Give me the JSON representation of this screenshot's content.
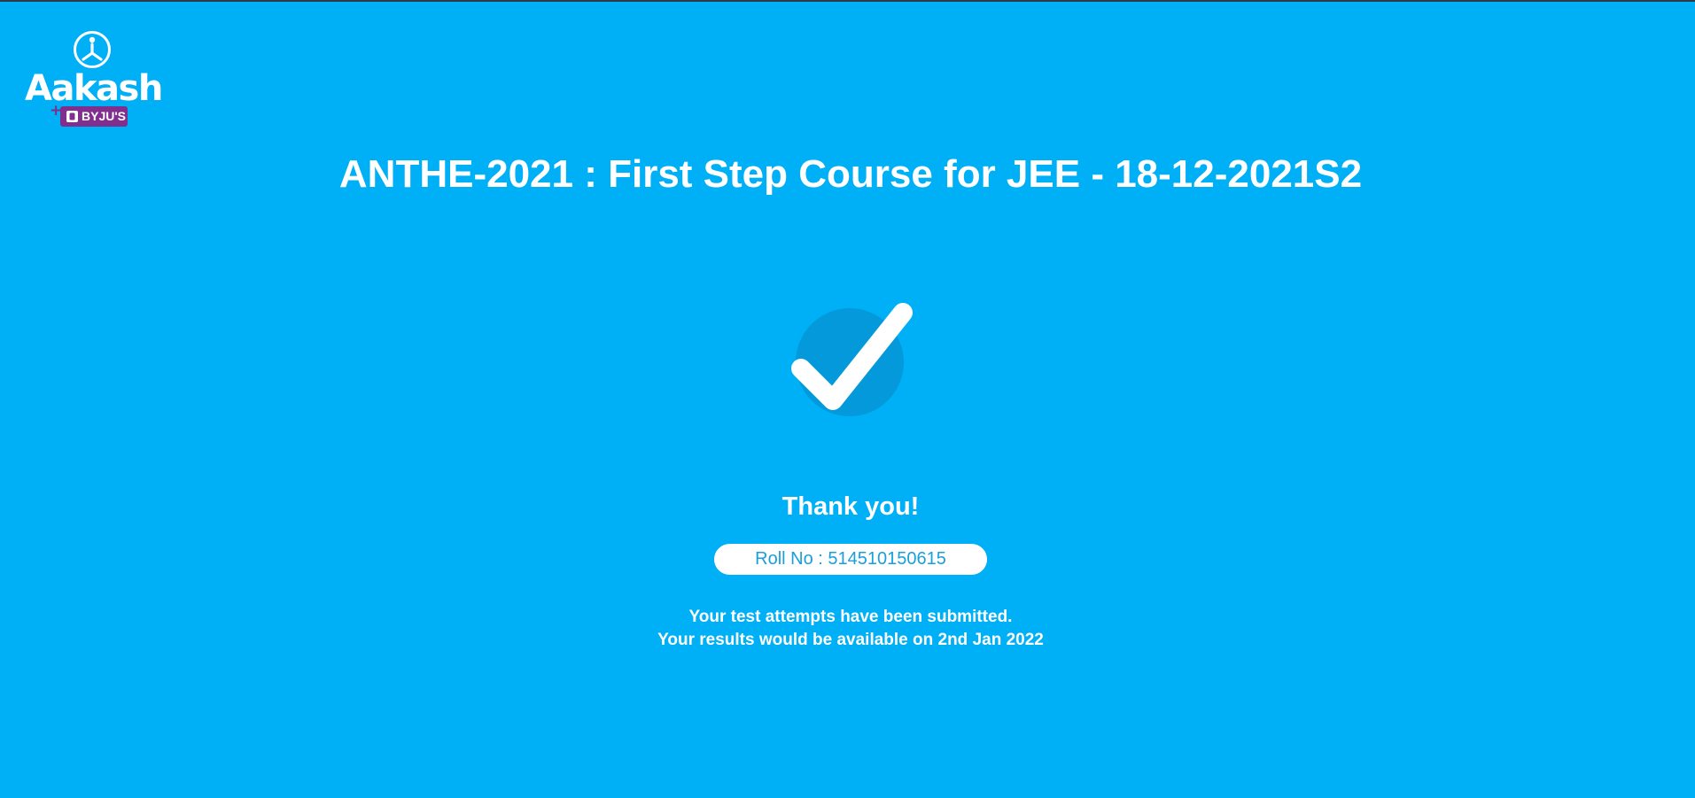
{
  "brand": {
    "logo_icon": "aakash-person-icon",
    "logo_word": "Aakash",
    "plus": "+",
    "partner": "BYJU'S",
    "partner_icon": "byjus-b-icon",
    "partner_color": "#812f8f"
  },
  "page": {
    "title": "ANTHE-2021 : First Step Course for JEE - 18-12-2021S2",
    "background": "#00b0f6"
  },
  "status": {
    "icon": "checkmark-icon",
    "heading": "Thank you!",
    "roll_label": "Roll No : 514510150615",
    "message_line1": "Your test attempts have been submitted.",
    "message_line2": "Your results would be available on 2nd Jan 2022"
  }
}
